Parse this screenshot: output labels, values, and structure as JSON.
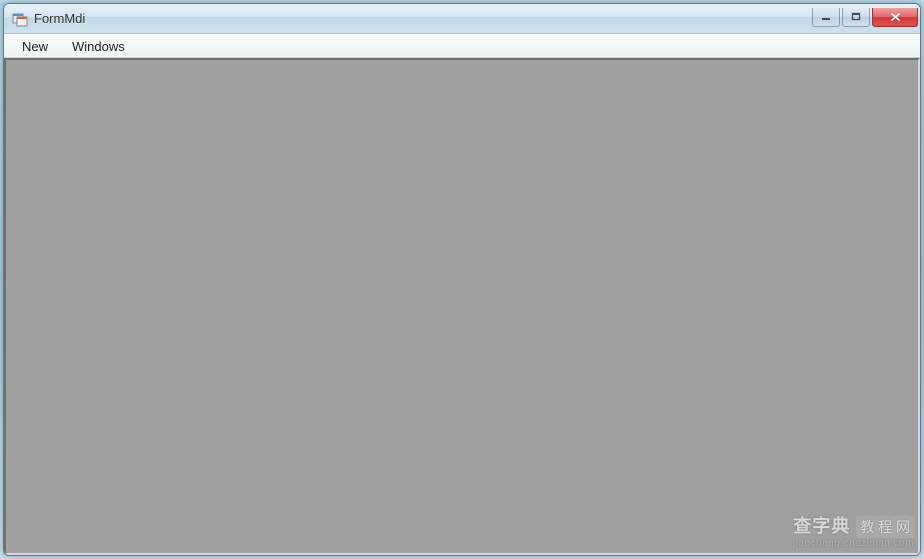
{
  "window": {
    "title": "FormMdi"
  },
  "menubar": {
    "items": [
      {
        "label": "New"
      },
      {
        "label": "Windows"
      }
    ]
  },
  "watermark": {
    "main": "查字典",
    "box": "教 程 网",
    "sub": "jiaocheng.chazidian.com"
  }
}
